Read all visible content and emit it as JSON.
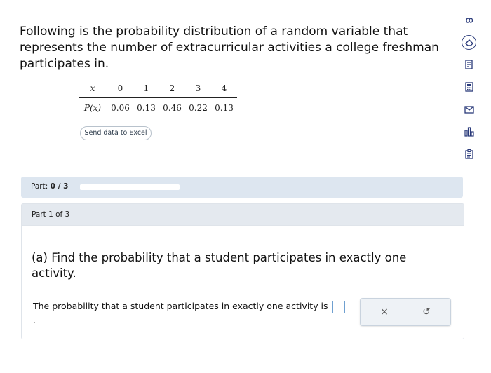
{
  "problem": {
    "text": "Following is the probability distribution of a random variable that represents the number of extracurricular activities a college freshman participates in."
  },
  "table": {
    "x_label": "x",
    "px_label": "P(x)",
    "x_values": [
      "0",
      "1",
      "2",
      "3",
      "4"
    ],
    "p_values": [
      "0.06",
      "0.13",
      "0.46",
      "0.22",
      "0.13"
    ]
  },
  "excel_button": {
    "label": "Send data to Excel"
  },
  "right_rail": {
    "icons": [
      "infinity-icon",
      "eraser-icon",
      "notes-icon",
      "calculator-icon",
      "mail-icon",
      "bar-chart-icon",
      "clipboard-icon"
    ]
  },
  "progress": {
    "prefix": "Part:",
    "value": "0 / 3",
    "fraction": 0
  },
  "part": {
    "header": "Part 1 of 3",
    "question": "(a) Find the probability that a student participates in exactly one activity.",
    "answer_prefix": "The probability that a student participates in exactly one activity is",
    "answer_suffix": "."
  },
  "tools": {
    "clear_symbol": "×",
    "undo_symbol": "↺"
  },
  "colors": {
    "accent": "#2a3a7a",
    "progress_bg": "#dde6f0",
    "header_bg": "#e4e9ef"
  }
}
